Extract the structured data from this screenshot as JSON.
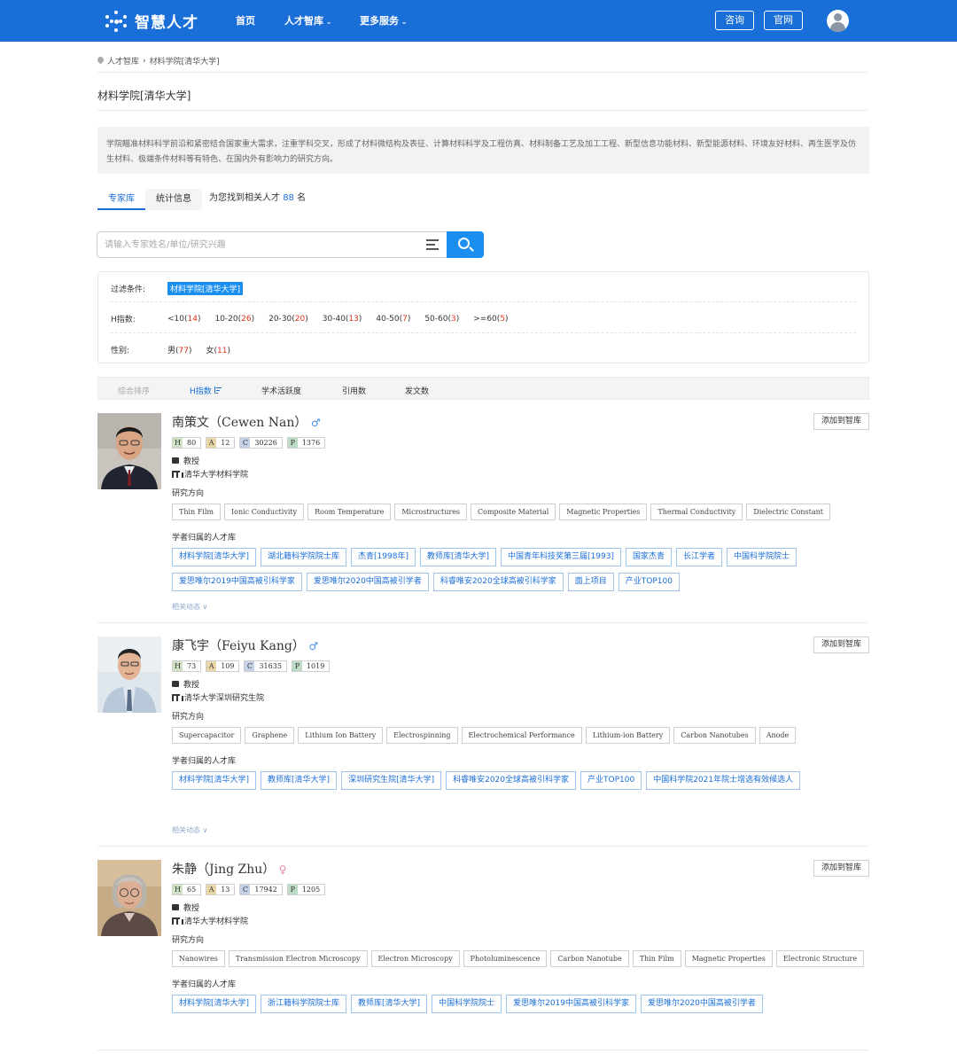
{
  "header": {
    "brand": "智慧人才",
    "nav": [
      "首页",
      "人才智库",
      "更多服务"
    ],
    "consult_label": "咨询",
    "official_label": "官网"
  },
  "breadcrumb": [
    "人才智库",
    "材料学院[清华大学]"
  ],
  "page_title": "材料学院[清华大学]",
  "description": "学院瞄准材料科学前沿和紧密结合国家重大需求，注重学科交叉，形成了材料微结构及表征、计算材料科学及工程仿真、材料制备工艺及加工工程、新型信息功能材料、新型能源材料、环境友好材料、再生医学及仿生材料、极端条件材料等有特色、在国内外有影响力的研究方向。",
  "tabs": [
    "专家库",
    "统计信息"
  ],
  "found": {
    "prefix": "为您找到相关人才",
    "count": "88",
    "suffix": "名"
  },
  "search": {
    "placeholder": "请输入专家姓名/单位/研究兴趣"
  },
  "filters": {
    "condition_label": "过滤条件:",
    "condition_value": "材料学院[清华大学]",
    "h_label": "H指数:",
    "h_options": [
      {
        "label": "<10",
        "count": "14"
      },
      {
        "label": "10-20",
        "count": "26"
      },
      {
        "label": "20-30",
        "count": "20"
      },
      {
        "label": "30-40",
        "count": "13"
      },
      {
        "label": "40-50",
        "count": "7"
      },
      {
        "label": "50-60",
        "count": "3"
      },
      {
        "label": ">=60",
        "count": "5"
      }
    ],
    "gender_label": "性别:",
    "gender_options": [
      {
        "label": "男",
        "count": "77"
      },
      {
        "label": "女",
        "count": "11"
      }
    ]
  },
  "sort": [
    "综合排序",
    "H指数",
    "学术活跃度",
    "引用数",
    "发文数"
  ],
  "labels": {
    "research": "研究方向",
    "libraries": "学者归属的人才库",
    "dynamics": "相关动态",
    "add": "添加到智库"
  },
  "experts": [
    {
      "name": "南策文（Cewen Nan）",
      "gender": "♂",
      "gender_color": "#4a90e2",
      "h": "80",
      "a": "12",
      "c": "30226",
      "p": "1376",
      "title": "教授",
      "org": "清华大学材料学院",
      "keywords": [
        "Thin Film",
        "Ionic Conductivity",
        "Room Temperature",
        "Microstructures",
        "Composite Material",
        "Magnetic Properties",
        "Thermal Conductivity",
        "Dielectric Constant"
      ],
      "libraries_row1": [
        "材料学院[清华大学]",
        "湖北籍科学院院士库",
        "杰青[1998年]",
        "教师库[清华大学]",
        "中国青年科技奖第三届[1993]",
        "国家杰青",
        "长江学者",
        "中国科学院院士"
      ],
      "libraries_row2": [
        "爱思唯尔2019中国高被引科学家",
        "爱思唯尔2020中国高被引学者",
        "科睿唯安2020全球高被引科学家",
        "面上项目",
        "产业TOP100"
      ]
    },
    {
      "name": "康飞宇（Feiyu Kang）",
      "gender": "♂",
      "gender_color": "#4a90e2",
      "h": "73",
      "a": "109",
      "c": "31635",
      "p": "1019",
      "title": "教授",
      "org": "清华大学深圳研究生院",
      "keywords": [
        "Supercapacitor",
        "Graphene",
        "Lithium Ion Battery",
        "Electrospinning",
        "Electrochemical Performance",
        "Lithium-ion Battery",
        "Carbon Nanotubes",
        "Anode"
      ],
      "libraries_row1": [
        "材料学院[清华大学]",
        "教师库[清华大学]",
        "深圳研究生院[清华大学]",
        "科睿唯安2020全球高被引科学家",
        "产业TOP100",
        "中国科学院2021年院士增选有效候选人"
      ],
      "libraries_row2": []
    },
    {
      "name": "朱静（Jing Zhu）",
      "gender": "♀",
      "gender_color": "#e88ca8",
      "h": "65",
      "a": "13",
      "c": "17942",
      "p": "1205",
      "title": "教授",
      "org": "清华大学材料学院",
      "keywords": [
        "Nanowires",
        "Transmission Electron Microscopy",
        "Electron Microscopy",
        "Photoluminescence",
        "Carbon Nanotube",
        "Thin Film",
        "Magnetic Properties",
        "Electronic Structure"
      ],
      "libraries_row1": [
        "材料学院[清华大学]",
        "浙江籍科学院院士库",
        "教师库[清华大学]",
        "中国科学院院士",
        "爱思唯尔2019中国高被引科学家",
        "爱思唯尔2020中国高被引学者"
      ],
      "libraries_row2": []
    }
  ]
}
